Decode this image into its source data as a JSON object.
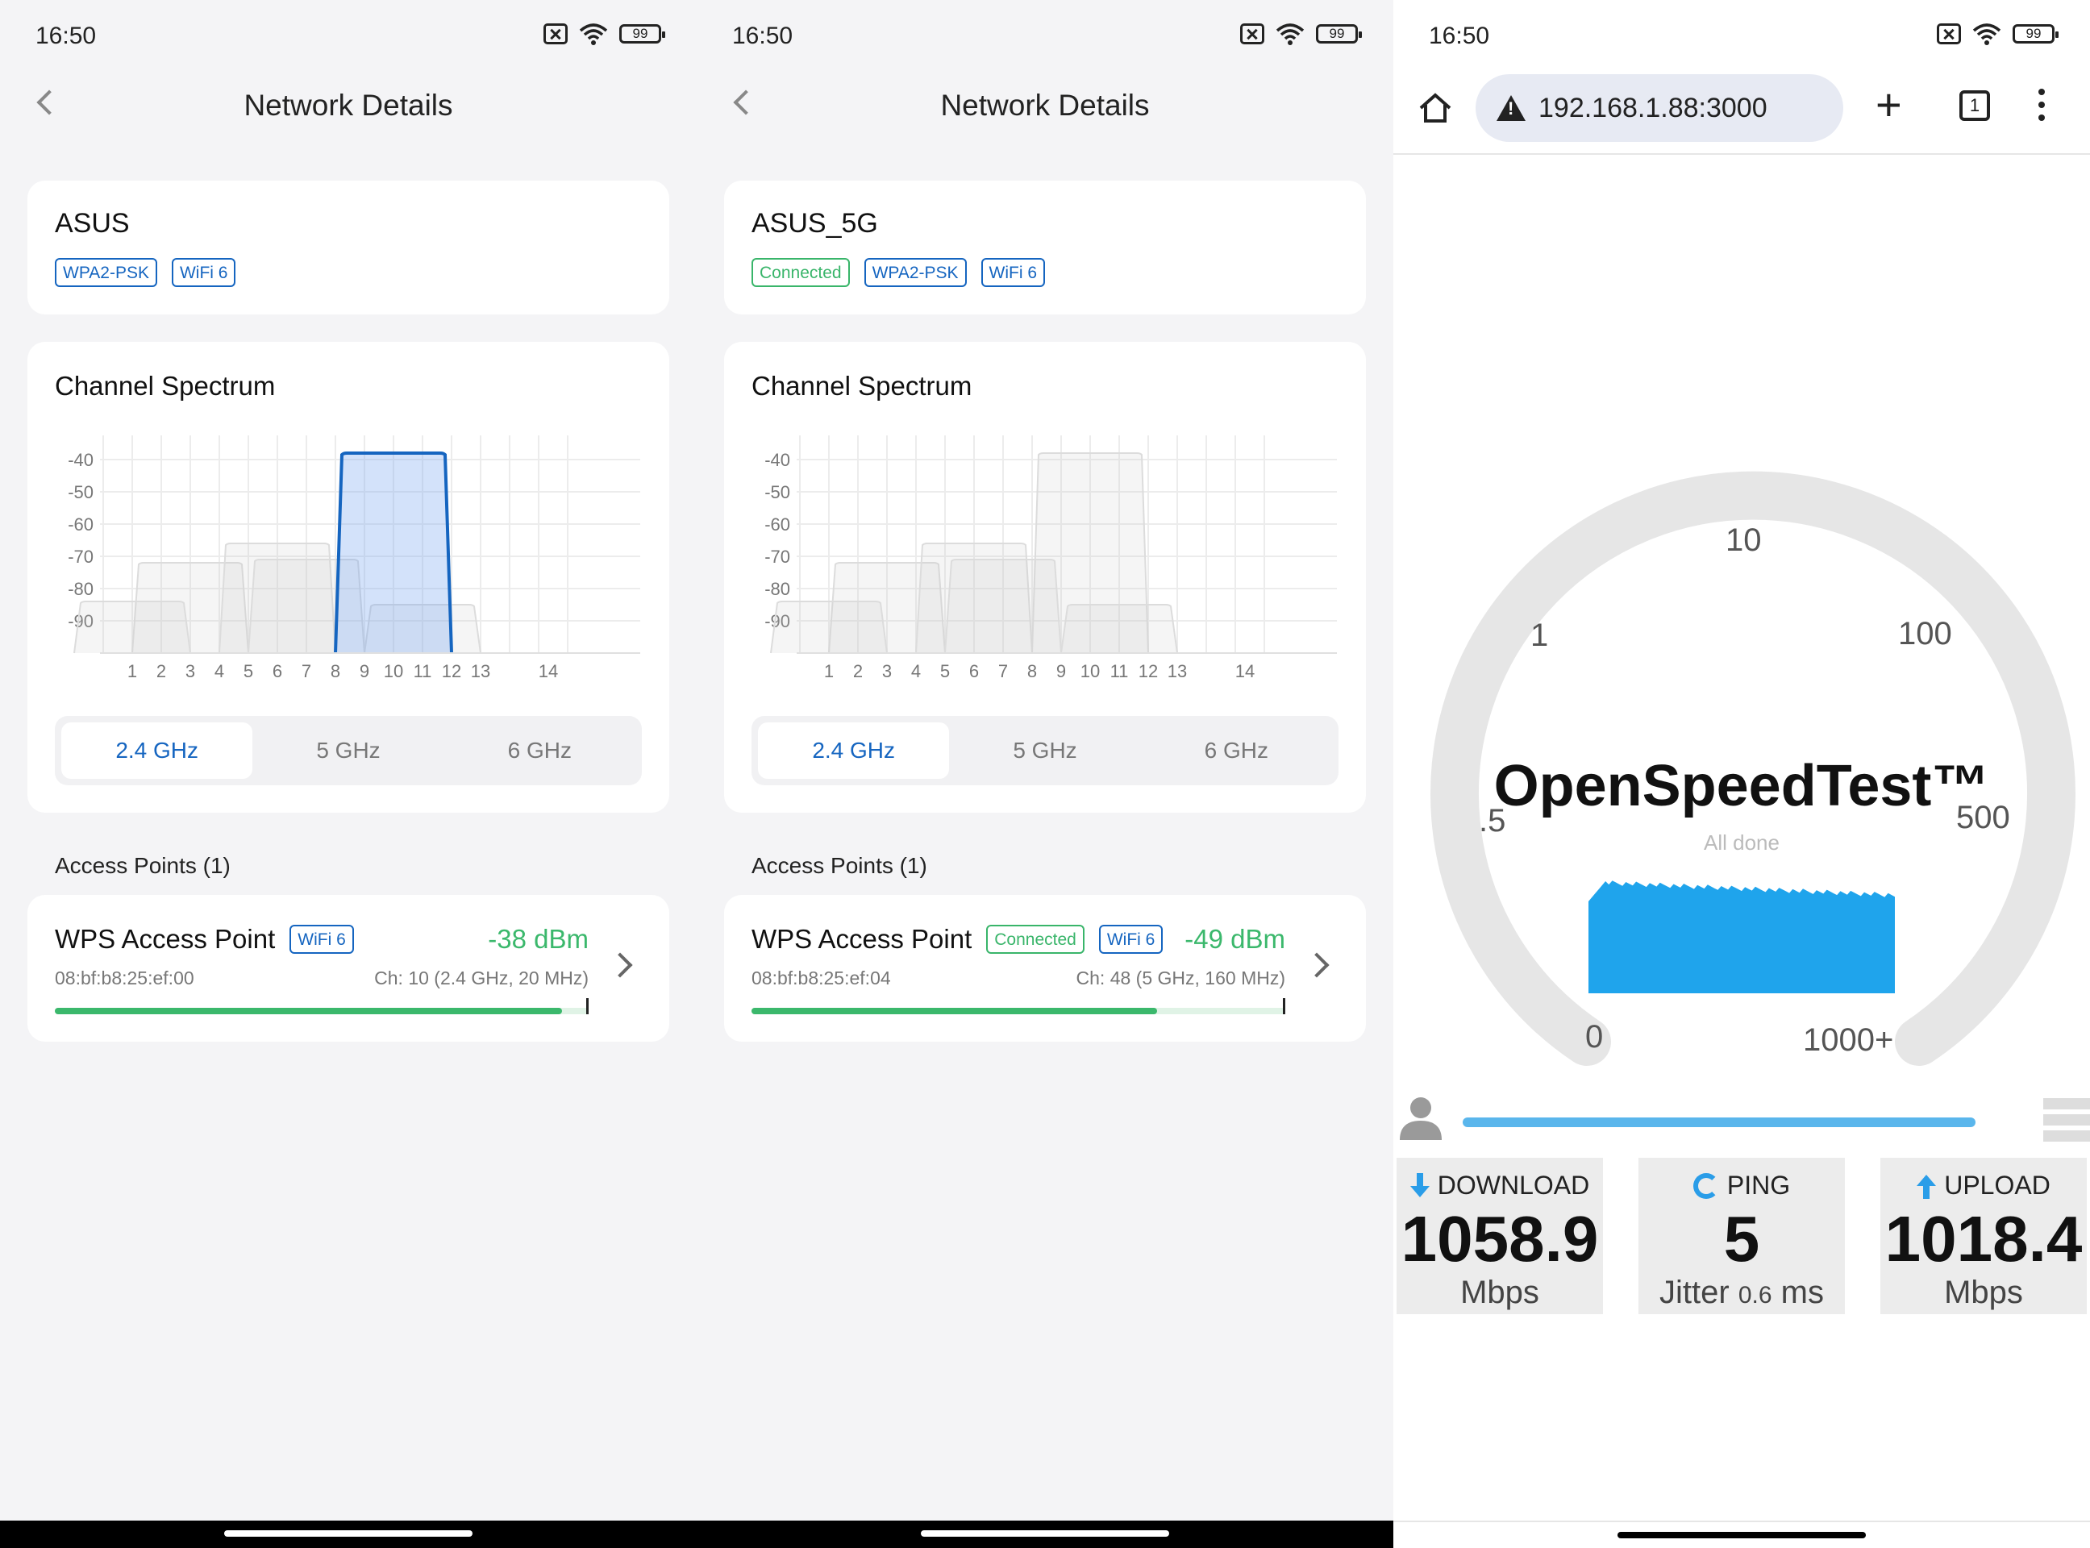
{
  "status": {
    "time": "16:50",
    "battery": "99"
  },
  "panel1": {
    "title": "Network Details",
    "ssid": "ASUS",
    "tags": [
      "WPA2-PSK",
      "WiFi 6"
    ],
    "spectrum_title": "Channel Spectrum",
    "bands": [
      "2.4 GHz",
      "5 GHz",
      "6 GHz"
    ],
    "active_band": 0,
    "ap_header": "Access Points (1)",
    "ap": {
      "name": "WPS Access Point",
      "tags": [
        "WiFi 6"
      ],
      "dbm": "-38 dBm",
      "mac": "08:bf:b8:25:ef:00",
      "channel": "Ch: 10 (2.4 GHz, 20 MHz)",
      "signal_fraction": 0.95
    }
  },
  "panel2": {
    "title": "Network Details",
    "ssid": "ASUS_5G",
    "tags": [
      "Connected",
      "WPA2-PSK",
      "WiFi 6"
    ],
    "spectrum_title": "Channel Spectrum",
    "bands": [
      "2.4 GHz",
      "5 GHz",
      "6 GHz"
    ],
    "active_band": 0,
    "ap_header": "Access Points (1)",
    "ap": {
      "name": "WPS Access Point",
      "tags": [
        "Connected",
        "WiFi 6"
      ],
      "dbm": "-49 dBm",
      "mac": "08:bf:b8:25:ef:04",
      "channel": "Ch: 48 (5 GHz, 160 MHz)",
      "signal_fraction": 0.76
    }
  },
  "chart_data": [
    {
      "type": "area",
      "y_ticks": [
        "-40",
        "-50",
        "-60",
        "-70",
        "-80",
        "-90"
      ],
      "x_ticks": [
        "1",
        "2",
        "3",
        "4",
        "5",
        "6",
        "7",
        "8",
        "9",
        "10",
        "11",
        "12",
        "13",
        "14"
      ],
      "ylim": [
        -100,
        -35
      ],
      "highlight": {
        "channel": 10,
        "level": -38
      },
      "background_networks": [
        {
          "channel": 3,
          "level": -72
        },
        {
          "channel": 6,
          "level": -66
        },
        {
          "channel": 7,
          "level": -71
        },
        {
          "channel": 11,
          "level": -85
        },
        {
          "channel": 1,
          "level": -84
        }
      ]
    },
    {
      "type": "area",
      "y_ticks": [
        "-40",
        "-50",
        "-60",
        "-70",
        "-80",
        "-90"
      ],
      "x_ticks": [
        "1",
        "2",
        "3",
        "4",
        "5",
        "6",
        "7",
        "8",
        "9",
        "10",
        "11",
        "12",
        "13",
        "14"
      ],
      "ylim": [
        -100,
        -35
      ],
      "highlight": null,
      "background_networks": [
        {
          "channel": 10,
          "level": -38
        },
        {
          "channel": 3,
          "level": -72
        },
        {
          "channel": 6,
          "level": -66
        },
        {
          "channel": 7,
          "level": -71
        },
        {
          "channel": 11,
          "level": -85
        },
        {
          "channel": 1,
          "level": -84
        }
      ]
    }
  ],
  "browser": {
    "url": "192.168.1.88:3000",
    "tab_count": "1",
    "gauge_ticks": [
      "0",
      ".5",
      "1",
      "10",
      "100",
      "500",
      "1000+"
    ],
    "brand": "OpenSpeedTest™",
    "state": "All done",
    "download_label": "DOWNLOAD",
    "download_value": "1058.9",
    "download_unit": "Mbps",
    "ping_label": "PING",
    "ping_value": "5",
    "jitter_label": "Jitter",
    "jitter_value": "0.6",
    "jitter_unit": "ms",
    "upload_label": "UPLOAD",
    "upload_value": "1018.4",
    "upload_unit": "Mbps",
    "accent": "#2a9de8"
  }
}
